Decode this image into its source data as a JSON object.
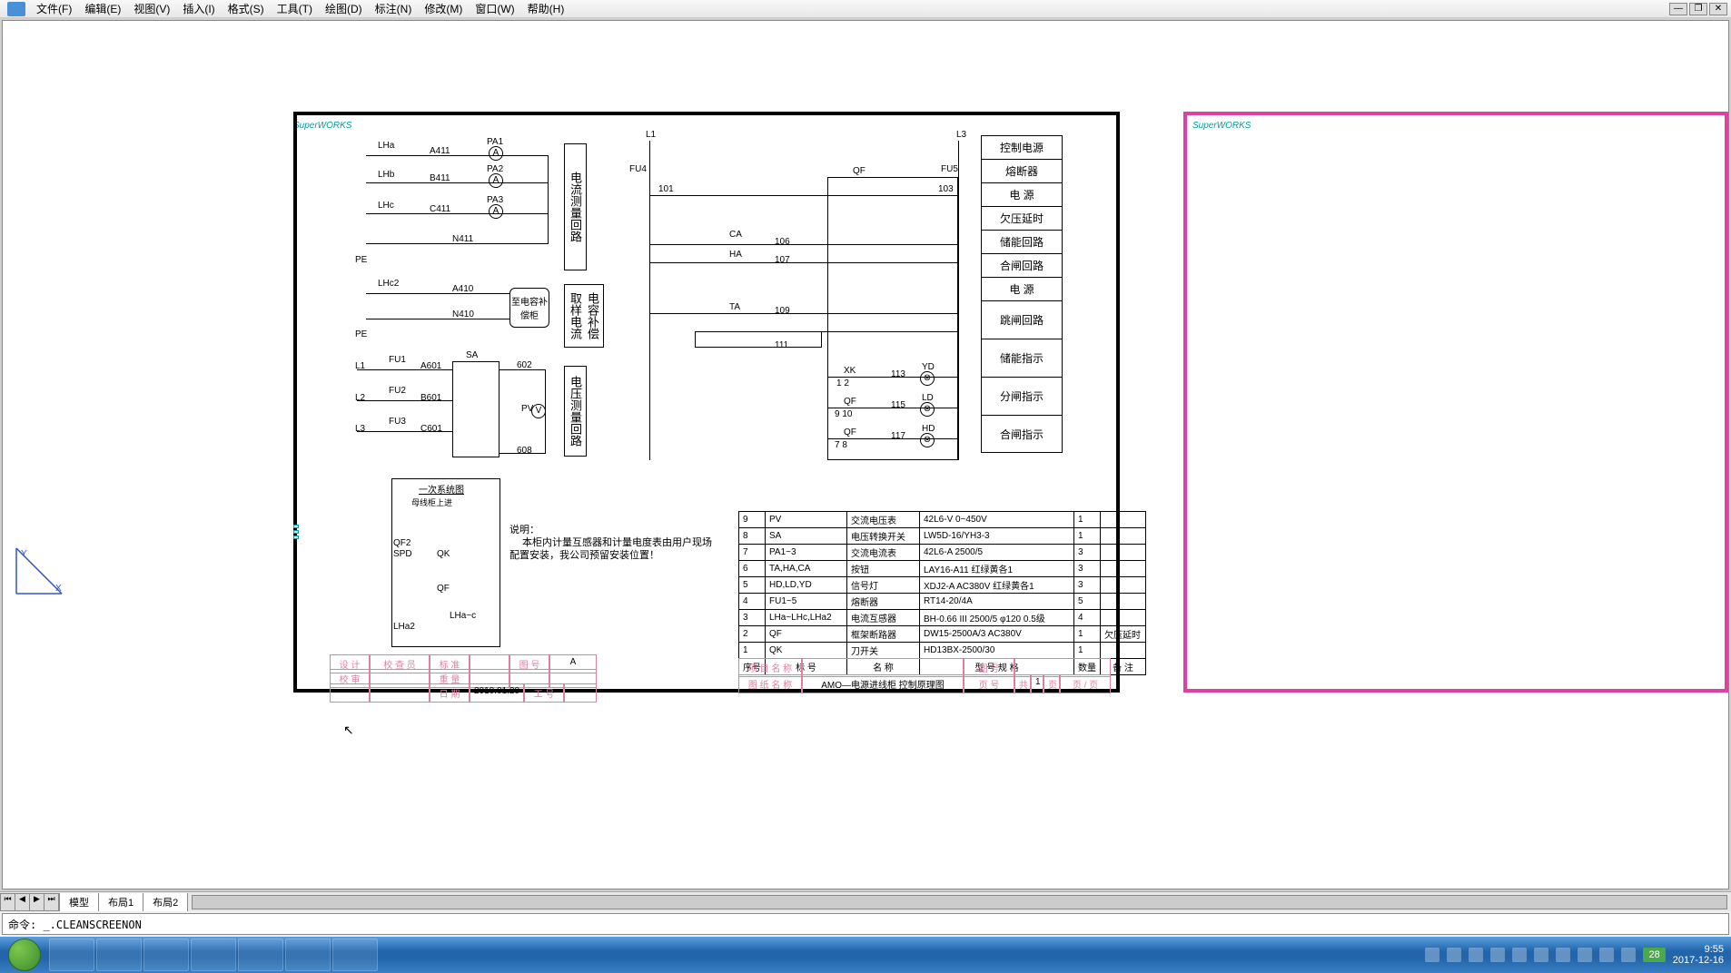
{
  "menu": {
    "file": "文件(F)",
    "edit": "编辑(E)",
    "view": "视图(V)",
    "insert": "插入(I)",
    "format": "格式(S)",
    "tool": "工具(T)",
    "draw": "绘图(D)",
    "dim": "标注(N)",
    "modify": "修改(M)",
    "window": "窗口(W)",
    "help": "帮助(H)"
  },
  "supervorks": "SuperWORKS",
  "vbox1": "电流测量回路",
  "vbox2": "电容补偿取样电流",
  "vbox3": "电压测量回路",
  "capbox": "至电容补偿柜",
  "rightBlock": [
    "控制电源",
    "熔断器",
    "电 源",
    "欠压延时",
    "储能回路",
    "合闸回路",
    "电 源",
    "跳闸回路",
    "储能指示",
    "分闸指示",
    "合闸指示"
  ],
  "sysTitle": "一次系统图",
  "sysSub": "母线柜上进",
  "noteTitle": "说明：",
  "note1": "本柜内计量互感器和计量电度表由用户现场",
  "note2": "配置安装，我公司预留安装位置！",
  "labels": {
    "LHa": "LHa",
    "LHb": "LHb",
    "LHc": "LHc",
    "LHc2": "LHc2",
    "PA1": "PA1",
    "PA2": "PA2",
    "PA3": "PA3",
    "A411": "A411",
    "B411": "B411",
    "C411": "C411",
    "N411": "N411",
    "A410": "A410",
    "N410": "N410",
    "PE": "PE",
    "L1": "L1",
    "L2": "L2",
    "L3": "L3",
    "FU1": "FU1",
    "FU2": "FU2",
    "FU3": "FU3",
    "FU4": "FU4",
    "FU5": "FU5",
    "A601": "A601",
    "B601": "B601",
    "C601": "C601",
    "SA": "SA",
    "PV": "PV",
    "n602": "602",
    "n608": "608",
    "QF": "QF",
    "QF2": "QF2",
    "SPD": "SPD",
    "QK": "QK",
    "LHa2": "LHa2",
    "LHac": "LHa~c",
    "n101": "101",
    "n103": "103",
    "CA": "CA",
    "HA": "HA",
    "TA": "TA",
    "n106": "106",
    "n107": "107",
    "n109": "109",
    "n111": "111",
    "XK": "XK",
    "YD": "YD",
    "LD": "LD",
    "HD": "HD",
    "n12": "1   2",
    "n910": "9    10",
    "n78": "7    8",
    "n113": "113",
    "n115": "115",
    "n117": "117",
    "A": "A",
    "V": "V"
  },
  "bom": [
    {
      "n": "9",
      "tag": "PV",
      "name": "交流电压表",
      "spec": "42L6-V 0~450V",
      "qty": "1",
      "note": ""
    },
    {
      "n": "8",
      "tag": "SA",
      "name": "电压转换开关",
      "spec": "LW5D-16/YH3-3",
      "qty": "1",
      "note": ""
    },
    {
      "n": "7",
      "tag": "PA1~3",
      "name": "交流电流表",
      "spec": "42L6-A 2500/5",
      "qty": "3",
      "note": ""
    },
    {
      "n": "6",
      "tag": "TA,HA,CA",
      "name": "按钮",
      "spec": "LAY16-A11  红绿黄各1",
      "qty": "3",
      "note": ""
    },
    {
      "n": "5",
      "tag": "HD,LD,YD",
      "name": "信号灯",
      "spec": "XDJ2-A AC380V 红绿黄各1",
      "qty": "3",
      "note": ""
    },
    {
      "n": "4",
      "tag": "FU1~5",
      "name": "熔断器",
      "spec": "RT14-20/4A",
      "qty": "5",
      "note": ""
    },
    {
      "n": "3",
      "tag": "LHa~LHc,LHa2",
      "name": "电流互感器",
      "spec": "BH-0.66 III 2500/5 φ120 0.5级",
      "qty": "4",
      "note": ""
    },
    {
      "n": "2",
      "tag": "QF",
      "name": "框架断路器",
      "spec": "DW15-2500A/3 AC380V",
      "qty": "1",
      "note": "欠压延时"
    },
    {
      "n": "1",
      "tag": "QK",
      "name": "刀开关",
      "spec": "HD13BX-2500/30",
      "qty": "1",
      "note": ""
    }
  ],
  "bomHead": {
    "n": "序号",
    "tag": "标    号",
    "name": "名    称",
    "spec": "型  号 规  格",
    "qty": "数量",
    "note": "备 注"
  },
  "titleBlock": {
    "projName": "项 目 名 称",
    "drawNo": "图    号",
    "drawName": "图 纸 名 称",
    "drawTitle": "AMO—电源进线柜 控制原理图",
    "page": "页    号",
    "total": "共",
    "one": "1",
    "pageWord": "页",
    "of": "页 /   页",
    "design": "设  计",
    "check": "校 查 员",
    "std": "标  准",
    "figNo": "图  号",
    "aLetter": "A",
    "review": "校  审",
    "weight": "重  量",
    "date": "日 期",
    "dateVal": "2010.01.20",
    "wo": "工  号"
  },
  "tabs": {
    "model": "模型",
    "layout1": "布局1",
    "layout2": "布局2"
  },
  "command": "命令: _.CLEANSCREENON",
  "cmdLabel": "命令:",
  "clock": {
    "time": "9:55",
    "date": "2017-12-16",
    "temp": "28"
  }
}
